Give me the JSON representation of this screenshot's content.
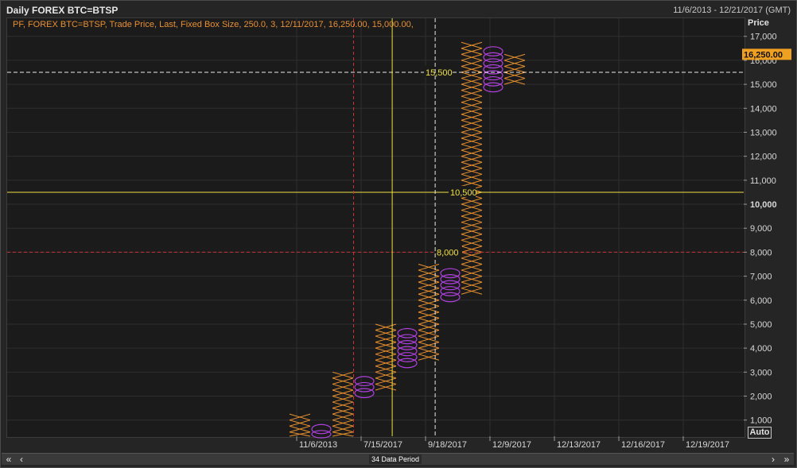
{
  "window": {
    "title": "Daily FOREX BTC=BTSP",
    "date_range": "11/6/2013 - 12/21/2017 (GMT)",
    "study_label": "PF, FOREX BTC=BTSP, Trade Price, Last, Fixed Box Size, 250.0, 3, 12/11/2017, 16,250.00, 15,000.00,",
    "y_axis_title": "Price",
    "auto_label": "Auto",
    "period_label": "34 Data Period"
  },
  "colors": {
    "x_mark": "#e8902e",
    "o_mark": "#b040e0",
    "yellow": "#f0e040",
    "red": "#d03030",
    "white_dash": "#e8e8e8",
    "last_price_bg": "#f0a020"
  },
  "chart_data": {
    "type": "point-and-figure",
    "box_size": 250,
    "reversal": 3,
    "ylim": [
      0,
      17500
    ],
    "y_ticks": [
      1000,
      2000,
      3000,
      4000,
      5000,
      6000,
      7000,
      8000,
      9000,
      10000,
      11000,
      12000,
      13000,
      14000,
      15000,
      16000,
      17000
    ],
    "y_tick_labels": [
      "1,000",
      "2,000",
      "3,000",
      "4,000",
      "5,000",
      "6,000",
      "7,000",
      "8,000",
      "9,000",
      "10,000",
      "11,000",
      "12,000",
      "13,000",
      "14,000",
      "15,000",
      "16,000",
      "17,000"
    ],
    "x_tick_labels": [
      "11/6/2013",
      "7/15/2017",
      "9/18/2017",
      "12/9/2017",
      "12/13/2017",
      "12/16/2017",
      "12/19/2017"
    ],
    "columns": [
      {
        "type": "X",
        "low": 0,
        "high": 1250
      },
      {
        "type": "O",
        "low": 0,
        "high": 750
      },
      {
        "type": "X",
        "low": 0,
        "high": 3000
      },
      {
        "type": "O",
        "low": 2000,
        "high": 2750
      },
      {
        "type": "X",
        "low": 2250,
        "high": 5000
      },
      {
        "type": "O",
        "low": 3250,
        "high": 4750
      },
      {
        "type": "X",
        "low": 3500,
        "high": 7500
      },
      {
        "type": "O",
        "low": 6000,
        "high": 7250
      },
      {
        "type": "X",
        "low": 6250,
        "high": 16750
      },
      {
        "type": "O",
        "low": 14750,
        "high": 16500
      },
      {
        "type": "X",
        "low": 15000,
        "high": 16250
      }
    ],
    "h_lines": [
      {
        "value": 15500,
        "label": "15,500",
        "style": "white_dash"
      },
      {
        "value": 10500,
        "label": "10,500",
        "style": "yellow"
      },
      {
        "value": 8000,
        "label": "8,000",
        "style": "red"
      }
    ],
    "v_lines": [
      {
        "column": 2.5,
        "style": "red"
      },
      {
        "column": 4.3,
        "style": "yellow"
      },
      {
        "column": 6.3,
        "style": "white_dash"
      }
    ],
    "last_price": 16250,
    "last_price_label": "16,250.00"
  }
}
